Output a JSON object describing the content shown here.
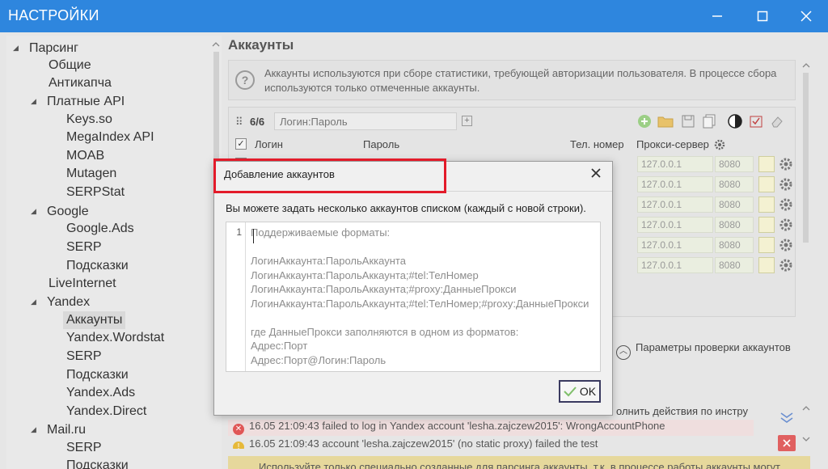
{
  "window": {
    "title": "НАСТРОЙКИ",
    "minimize_icon": "minimize-icon",
    "maximize_icon": "maximize-icon",
    "close_icon": "close-icon"
  },
  "sidebar": {
    "items": [
      {
        "label": "Парсинг",
        "expanded": true,
        "level": 0
      },
      {
        "label": "Общие",
        "level": 1
      },
      {
        "label": "Антикапча",
        "level": 1
      },
      {
        "label": "Платные API",
        "expanded": true,
        "level": 1
      },
      {
        "label": "Keys.so",
        "level": 2
      },
      {
        "label": "MegaIndex API",
        "level": 2
      },
      {
        "label": "MOAB",
        "level": 2
      },
      {
        "label": "Mutagen",
        "level": 2
      },
      {
        "label": "SERPStat",
        "level": 2
      },
      {
        "label": "Google",
        "expanded": true,
        "level": 1
      },
      {
        "label": "Google.Ads",
        "level": 2
      },
      {
        "label": "SERP",
        "level": 2
      },
      {
        "label": "Подсказки",
        "level": 2
      },
      {
        "label": "LiveInternet",
        "level": 1
      },
      {
        "label": "Yandex",
        "expanded": true,
        "level": 1
      },
      {
        "label": "Аккаунты",
        "level": 2,
        "selected": true
      },
      {
        "label": "Yandex.Wordstat",
        "level": 2
      },
      {
        "label": "SERP",
        "level": 2
      },
      {
        "label": "Подсказки",
        "level": 2
      },
      {
        "label": "Yandex.Ads",
        "level": 2
      },
      {
        "label": "Yandex.Direct",
        "level": 2
      },
      {
        "label": "Mail.ru",
        "expanded": true,
        "level": 1
      },
      {
        "label": "SERP",
        "level": 2
      },
      {
        "label": "Подсказки",
        "level": 2
      }
    ]
  },
  "main": {
    "section_title": "Аккаунты",
    "info_text": "Аккаунты используются при сборе статистики, требующей авторизации пользователя. В процессе сбора используются только отмеченные аккаунты.",
    "accounts_count": "6/6",
    "filter_placeholder": "Логин:Пароль",
    "columns": {
      "login": "Логин",
      "password": "Пароль",
      "phone": "Тел. номер",
      "proxy": "Прокси-сервер"
    },
    "proxy_rows": [
      {
        "host": "127.0.0.1",
        "port": "8080"
      },
      {
        "host": "127.0.0.1",
        "port": "8080"
      },
      {
        "host": "127.0.0.1",
        "port": "8080"
      },
      {
        "host": "127.0.0.1",
        "port": "8080"
      },
      {
        "host": "127.0.0.1",
        "port": "8080"
      },
      {
        "host": "127.0.0.1",
        "port": "8080"
      }
    ],
    "check_params_label": "Параметры проверки аккаунтов",
    "action_text": "олнить действия по инстру",
    "log": [
      {
        "type": "error",
        "time": "16.05 21:09:43",
        "text": "failed to log in Yandex account 'lesha.zajczew2015': WrongAccountPhone"
      },
      {
        "type": "warning",
        "time": "16.05 21:09:43",
        "text": "account 'lesha.zajczew2015' (no static proxy) failed the test"
      }
    ],
    "bottom_warning": "Используйте только специально созданные для парсинга аккаунты, т.к. в процессе работы аккаунты могут"
  },
  "dialog": {
    "title": "Добавление аккаунтов",
    "hint": "Вы можете задать несколько аккаунтов списком (каждый с новой строки).",
    "line_number": "1",
    "placeholder_text": "Поддерживаемые форматы:\n\nЛогинАккаунта:ПарольАккаунта\nЛогинАккаунта:ПарольАккаунта;#tel:ТелНомер\nЛогинАккаунта:ПарольАккаунта;#proxy:ДанныеПрокси\nЛогинАккаунта:ПарольАккаунта;#tel:ТелНомер;#proxy:ДанныеПрокси\n\nгде ДанныеПрокси заполняются в одном из форматов:\nАдрес:Порт\nАдрес:Порт@Логин:Пароль",
    "ok_label": "OK"
  }
}
